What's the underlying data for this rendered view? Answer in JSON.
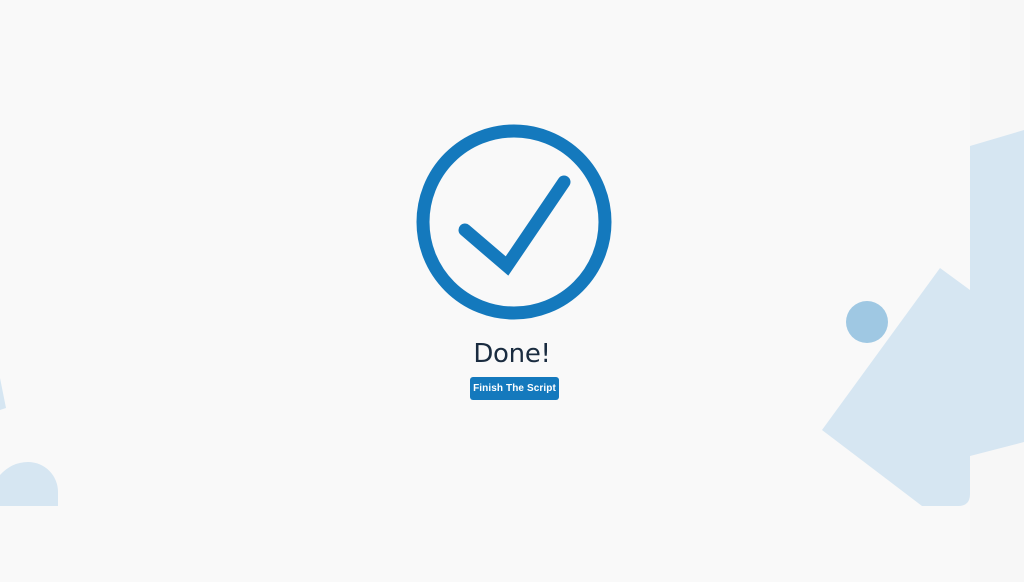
{
  "completion": {
    "title": "Done!",
    "finish_button_label": "Finish The Script",
    "status_icon": "check-circle-icon"
  },
  "colors": {
    "background": "#f9f9f9",
    "accent": "#1479bd",
    "title_text": "#1a2c40",
    "decor_light": "#d6e6f2",
    "decor_mid": "#9fc8e3"
  }
}
